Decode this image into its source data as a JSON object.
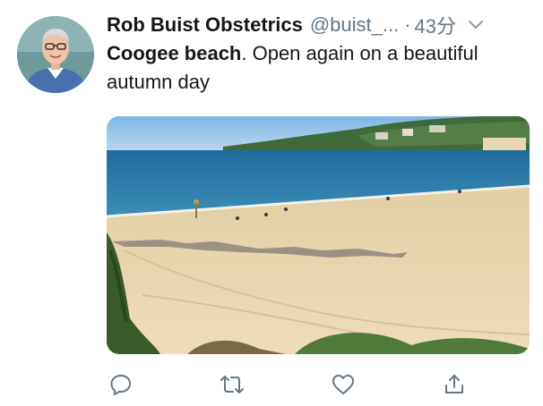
{
  "tweet": {
    "author_name": "Rob Buist Obstetrics",
    "handle": "@buist_...",
    "separator": "·",
    "time": "43分",
    "text_bold": "Coogee beach",
    "text_rest": ". Open again on a beautiful autumn day"
  },
  "icons": {
    "menu": "chevron-down-icon",
    "reply": "reply-icon",
    "retweet": "retweet-icon",
    "like": "heart-icon",
    "share": "share-icon"
  },
  "colors": {
    "text": "#14171a",
    "secondary": "#657786",
    "icon": "#657786"
  }
}
